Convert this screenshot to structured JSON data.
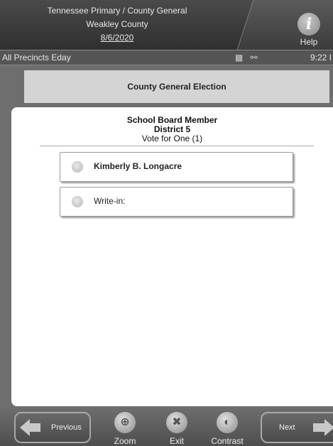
{
  "header": {
    "line1": "Tennessee Primary / County General",
    "line2": "Weakley County",
    "date": "8/6/2020",
    "help_label": "Help",
    "help_icon": "info-icon"
  },
  "status": {
    "precinct": "All Precincts Eday",
    "time": "9:22 I"
  },
  "election": {
    "title": "County General Election"
  },
  "contest": {
    "office": "School Board Member",
    "district": "District 5",
    "instruction": "Vote for One (1)"
  },
  "choices": [
    {
      "label": "Kimberly B. Longacre",
      "selected": false
    },
    {
      "label": "Write-in:",
      "selected": false
    }
  ],
  "footer": {
    "previous": "Previous",
    "next": "Next",
    "zoom": "Zoom",
    "exit": "Exit",
    "contrast": "Contrast"
  }
}
